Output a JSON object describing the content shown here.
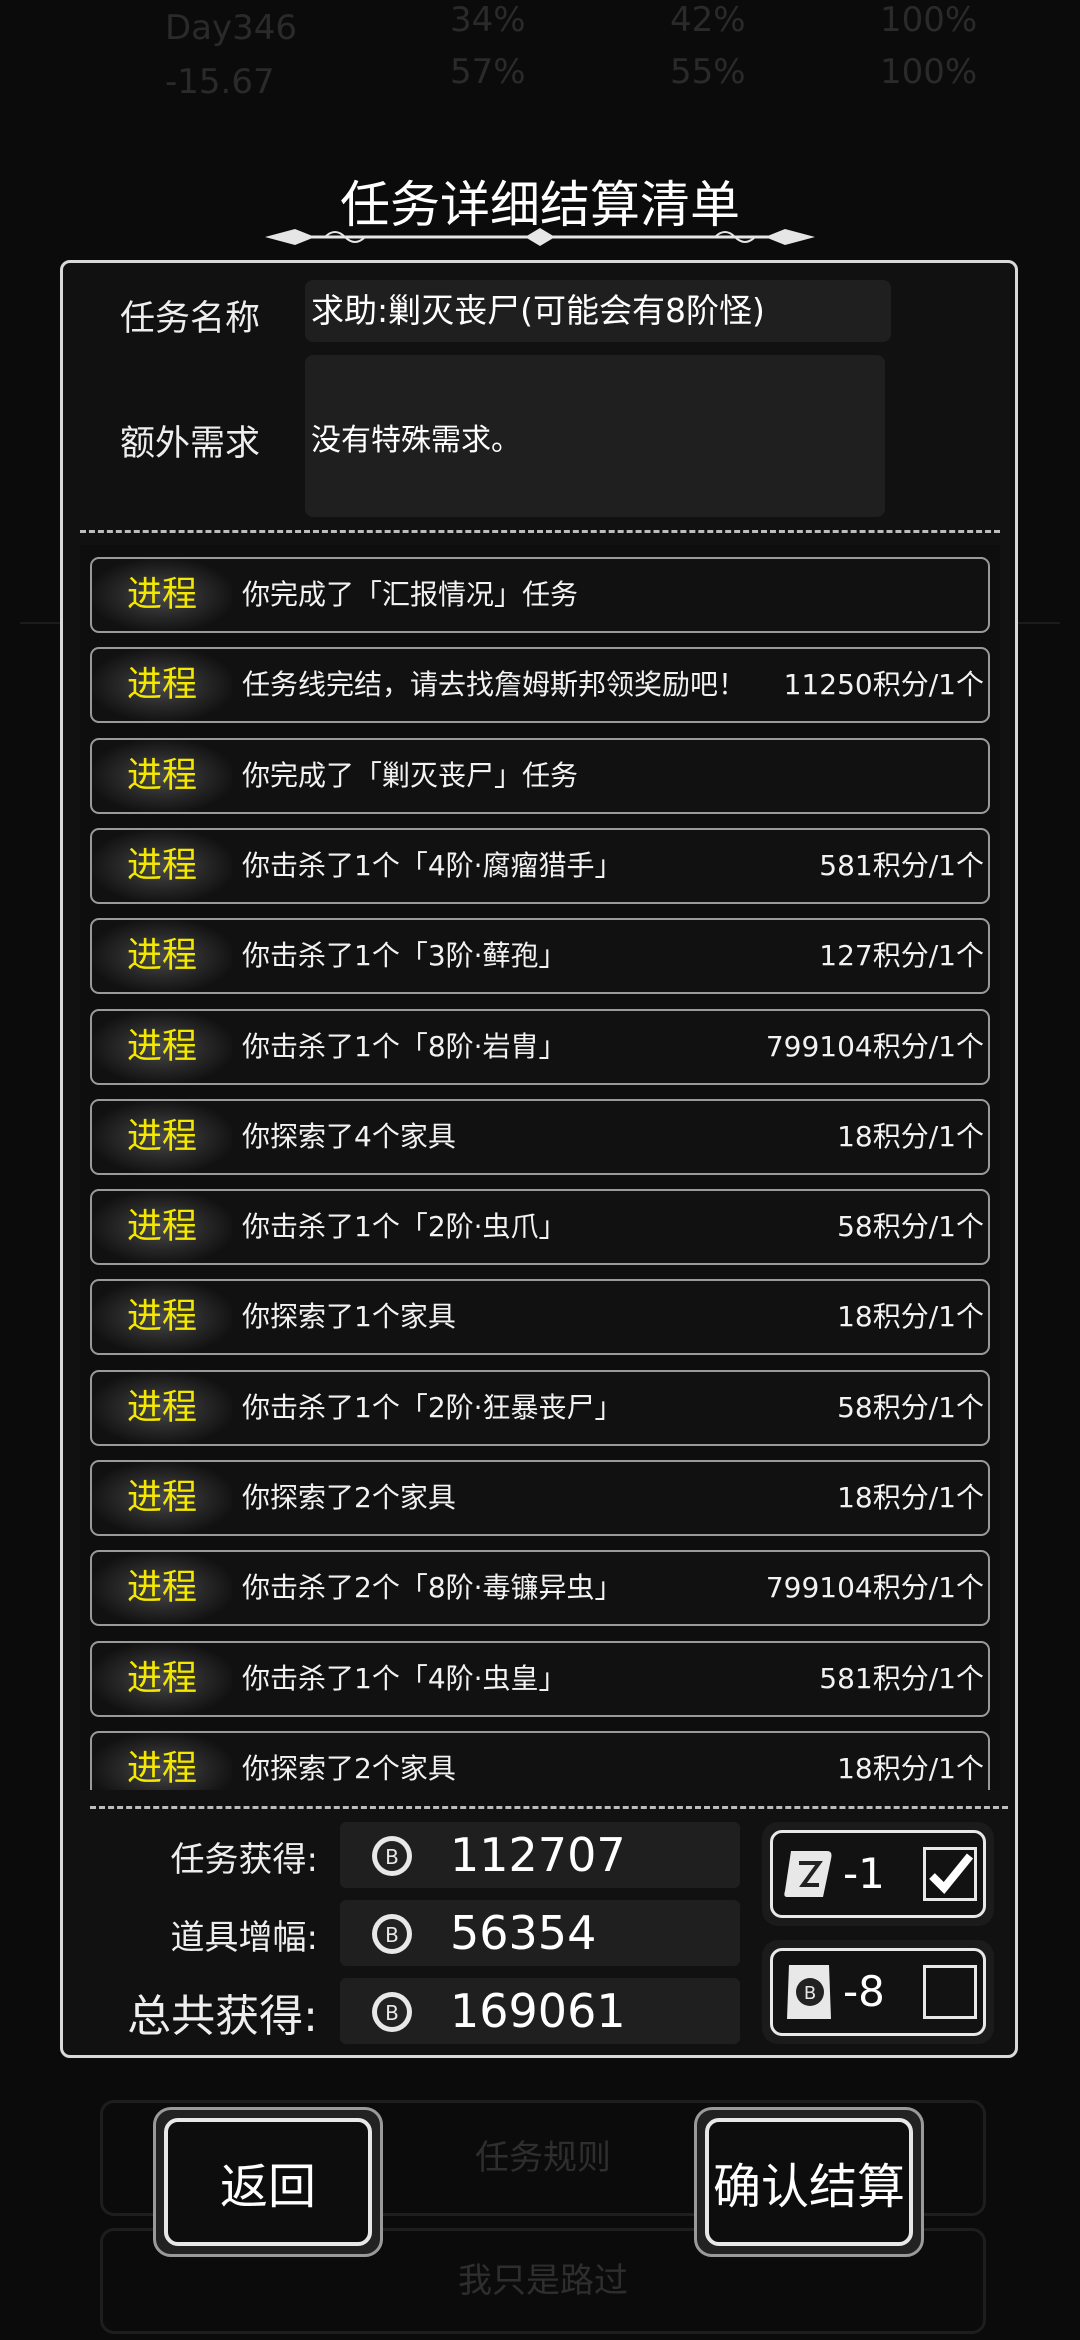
{
  "background": {
    "status_day": "Day346",
    "status_value": "-15.67",
    "pct_a": "34%",
    "pct_b": "42%",
    "pct_c": "100%",
    "pct_d": "57%",
    "pct_e": "55%",
    "pct_f": "100%",
    "rules_button": "任务规则",
    "pass_button": "我只是路过"
  },
  "dialog": {
    "title": "任务详细结算清单",
    "task_name_label": "任务名称",
    "task_name": "求助:剿灭丧尸(可能会有8阶怪)",
    "extra_label": "额外需求",
    "extra_text": "没有特殊需求。"
  },
  "entries": [
    {
      "tag": "进程",
      "desc": "你完成了「汇报情况」任务",
      "score": ""
    },
    {
      "tag": "进程",
      "desc": "任务线完结，请去找詹姆斯邦领奖励吧！",
      "score": "11250积分/1个"
    },
    {
      "tag": "进程",
      "desc": "你完成了「剿灭丧尸」任务",
      "score": ""
    },
    {
      "tag": "进程",
      "desc": "你击杀了1个「4阶·腐瘤猎手」",
      "score": "581积分/1个"
    },
    {
      "tag": "进程",
      "desc": "你击杀了1个「3阶·藓孢」",
      "score": "127积分/1个"
    },
    {
      "tag": "进程",
      "desc": "你击杀了1个「8阶·岩胄」",
      "score": "799104积分/1个"
    },
    {
      "tag": "进程",
      "desc": "你探索了4个家具",
      "score": "18积分/1个"
    },
    {
      "tag": "进程",
      "desc": "你击杀了1个「2阶·虫爪」",
      "score": "58积分/1个"
    },
    {
      "tag": "进程",
      "desc": "你探索了1个家具",
      "score": "18积分/1个"
    },
    {
      "tag": "进程",
      "desc": "你击杀了1个「2阶·狂暴丧尸」",
      "score": "58积分/1个"
    },
    {
      "tag": "进程",
      "desc": "你探索了2个家具",
      "score": "18积分/1个"
    },
    {
      "tag": "进程",
      "desc": "你击杀了2个「8阶·毒镰异虫」",
      "score": "799104积分/1个"
    },
    {
      "tag": "进程",
      "desc": "你击杀了1个「4阶·虫皇」",
      "score": "581积分/1个"
    },
    {
      "tag": "进程",
      "desc": "你探索了2个家具",
      "score": "18积分/1个"
    }
  ],
  "summary": {
    "earned_label": "任务获得:",
    "earned_value": "112707",
    "boost_label": "道具增幅:",
    "boost_value": "56354",
    "total_label": "总共获得:",
    "total_value": "169061"
  },
  "items": {
    "scroll_count": "-1",
    "scroll_checked": true,
    "coin_card_count": "-8",
    "coin_card_checked": false
  },
  "buttons": {
    "back": "返回",
    "confirm": "确认结算"
  }
}
